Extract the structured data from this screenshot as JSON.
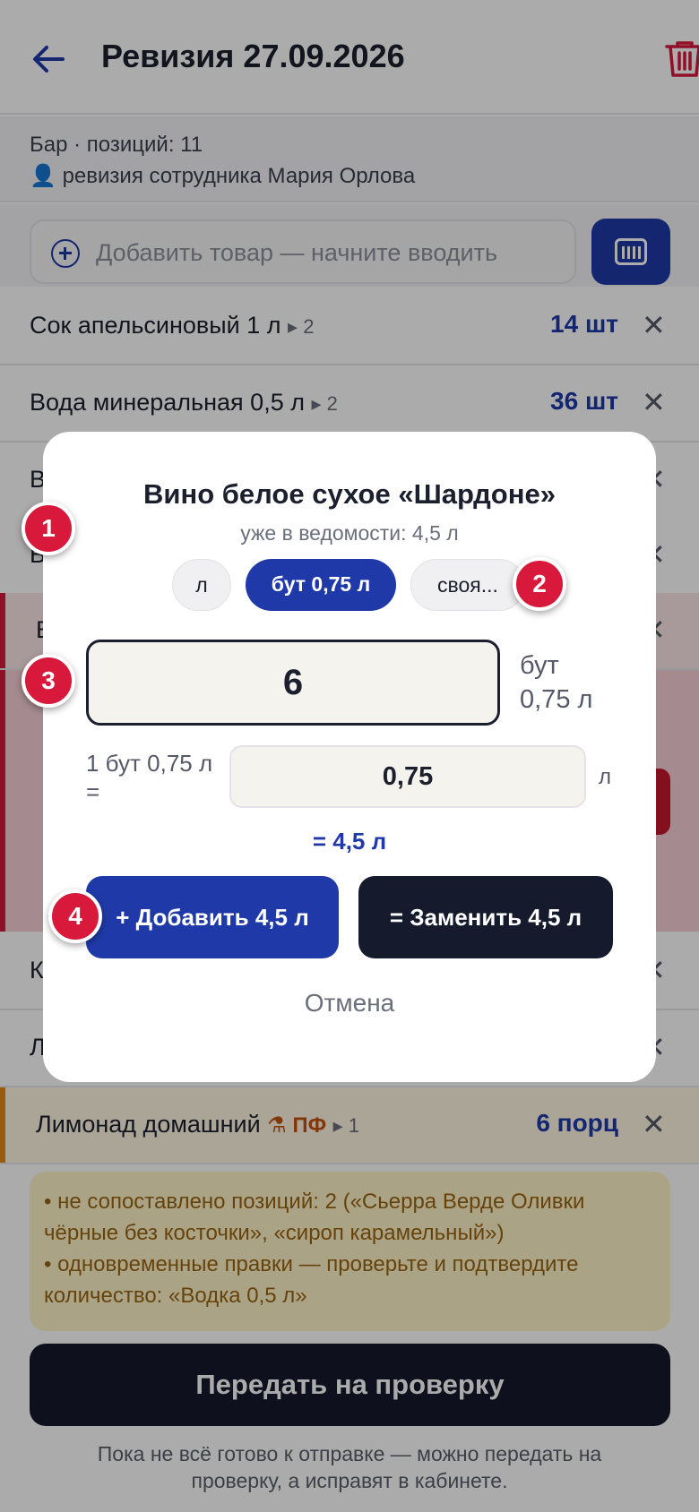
{
  "header": {
    "title": "Ревизия 27.09.2026"
  },
  "subinfo": {
    "line1": "Бар · позиций: 11",
    "person_icon": "👤",
    "line2": "ревизия сотрудника Мария Орлова"
  },
  "search": {
    "placeholder": "Добавить товар — начните вводить"
  },
  "rows": [
    {
      "name": "Сок апельсиновый 1 л",
      "count": "▸ 2",
      "qty": "14 шт"
    },
    {
      "name": "Вода минеральная 0,5 л",
      "count": "▸ 2",
      "qty": "36 шт"
    },
    {
      "name": "В"
    },
    {
      "name": "В"
    },
    {
      "name": "В"
    },
    {
      "name": "К"
    },
    {
      "name": "Л"
    },
    {
      "name": "Лимонад домашний",
      "tag": "⚗ ПФ",
      "count": "▸ 1",
      "qty": "6 порц"
    }
  ],
  "close_glyph": "✕",
  "notice": {
    "line1": "• не сопоставлено позиций: 2 («Сьерра Верде Оливки чёрные без косточки», «сироп карамельный»)",
    "line2": "• одновременные правки — проверьте и подтвердите количество: «Водка 0,5 л»"
  },
  "submit_label": "Передать на проверку",
  "foot_note": "Пока не всё готово к отправке — можно передать на проверку, а исправят в кабинете.",
  "modal": {
    "title": "Вино белое сухое «Шардоне»",
    "subtitle": "уже в ведомости: 4,5 л",
    "units": [
      "л",
      "бут 0,75 л",
      "своя..."
    ],
    "selected_unit": "бут 0,75 л",
    "quantity": "6",
    "quantity_unit": "бут 0,75 л",
    "quantity_unit_line1": "бут",
    "quantity_unit_line2": "0,75 л",
    "conversion_label": "1 бут 0,75 л =",
    "conversion_value": "0,75",
    "conversion_unit": "л",
    "total": "= 4,5 л",
    "add_label": "+ Добавить 4,5 л",
    "replace_label": "= Заменить 4,5 л",
    "cancel_label": "Отмена"
  },
  "badges": [
    "1",
    "2",
    "3",
    "4"
  ],
  "colors": {
    "accent": "#1f3aa8",
    "dark": "#151a2c",
    "danger": "#d8193b",
    "warning_text": "#9a6412",
    "semi_product": "#c2510f"
  }
}
